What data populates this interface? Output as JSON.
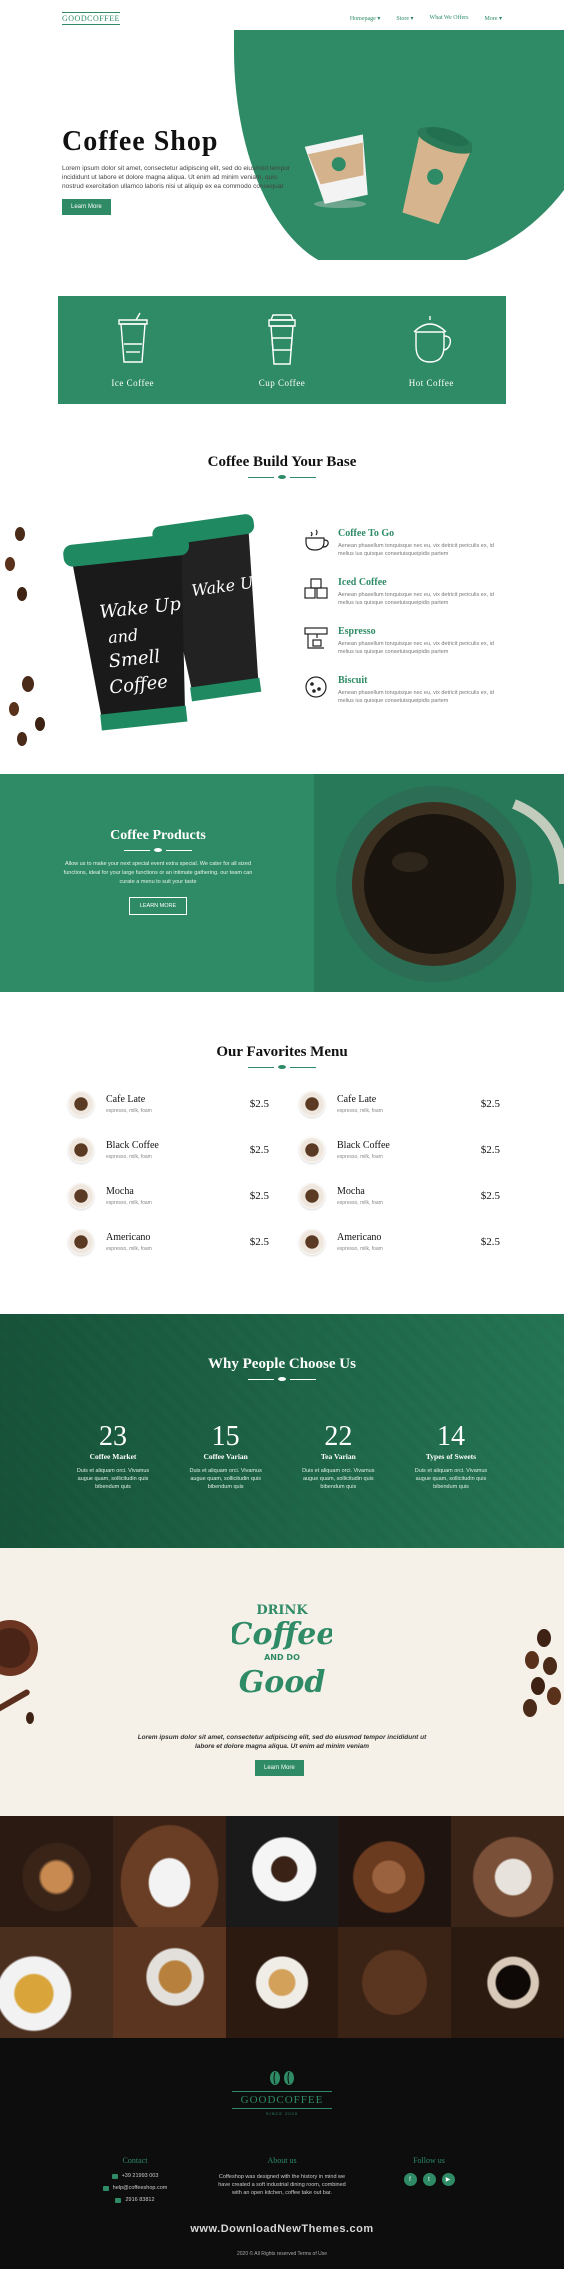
{
  "nav": {
    "logo": "GOODCOFFEE",
    "items": [
      {
        "label": "Homepage ▾"
      },
      {
        "label": "Store ▾"
      },
      {
        "label": "What We Offers"
      },
      {
        "label": "More ▾"
      }
    ]
  },
  "hero": {
    "title": "Coffee Shop",
    "text": "Lorem ipsum dolor sit amet, consectetur adipiscing elit, sed do eiusmod tempor incididunt ut labore et dolore magna aliqua. Ut enim ad minim veniam, quis nostrud exercitation ullamco laboris nisi ut aliquip ex ea commodo consequat",
    "button": "Learn More"
  },
  "categories": [
    {
      "label": "Ice Coffee"
    },
    {
      "label": "Cup Coffee"
    },
    {
      "label": "Hot Coffee"
    }
  ],
  "base": {
    "title": "Coffee Build Your Base",
    "features": [
      {
        "title": "Coffee To Go",
        "text": "Aenean phasellum tonquisque nec eu, vix detricit periculis ex, id melius ius quisque consetuisqueipidis partem"
      },
      {
        "title": "Iced Coffee",
        "text": "Aenean phasellum tonquisque nec eu, vix detricit periculis ex, id melius ius quisque consetuisqueipidis partem"
      },
      {
        "title": "Espresso",
        "text": "Aenean phasellum tonquisque nec eu, vix detricit periculis ex, id melius ius quisque consetuisqueipidis partem"
      },
      {
        "title": "Biscuit",
        "text": "Aenean phasellum tonquisque nec eu, vix detricit periculis ex, id melius ius quisque consetuisqueipidis partem"
      }
    ]
  },
  "products": {
    "title": "Coffee Products",
    "text": "Allow us to make your next special event extra special. We cater for all sized functions, ideal for your large functions or an intimate gathering. our team can curate a menu to suit your taste",
    "button": "LEARN MORE"
  },
  "favorites": {
    "title": "Our Favorites Menu",
    "items": [
      {
        "name": "Cafe Late",
        "desc": "espresso, milk, foam",
        "price": "$2.5"
      },
      {
        "name": "Cafe Late",
        "desc": "espresso, milk, foam",
        "price": "$2.5"
      },
      {
        "name": "Black Coffee",
        "desc": "espresso, milk, foam",
        "price": "$2.5"
      },
      {
        "name": "Black Coffee",
        "desc": "espresso, milk, foam",
        "price": "$2.5"
      },
      {
        "name": "Mocha",
        "desc": "espresso, milk, foam",
        "price": "$2.5"
      },
      {
        "name": "Mocha",
        "desc": "espresso, milk, foam",
        "price": "$2.5"
      },
      {
        "name": "Americano",
        "desc": "espresso, milk, foam",
        "price": "$2.5"
      },
      {
        "name": "Americano",
        "desc": "espresso, milk, foam",
        "price": "$2.5"
      }
    ]
  },
  "why": {
    "title": "Why People Choose Us",
    "stats": [
      {
        "number": "23",
        "label": "Coffee Market",
        "text": "Duis et aliquam orci. Vivamus augue quam, sollicitudin quis bibendum quis"
      },
      {
        "number": "15",
        "label": "Coffee Varian",
        "text": "Duis et aliquam orci. Vivamus augue quam, sollicitudin quis bibendum quis"
      },
      {
        "number": "22",
        "label": "Tea Varian",
        "text": "Duis et aliquam orci. Vivamus augue quam, sollicitudin quis bibendum quis"
      },
      {
        "number": "14",
        "label": "Types of Sweets",
        "text": "Duis et aliquam orci. Vivamus augue quam, sollicitudin quis bibendum quis"
      }
    ]
  },
  "drink": {
    "logo_line1": "DRINK",
    "logo_line2": "Coffee",
    "logo_line3": "AND DO",
    "logo_line4": "Good",
    "text": "Lorem ipsum dolor sit amet, consectetur adipiscing elit, sed do eiusmod tempor incididunt ut labore et dolore magna aliqua. Ut enim ad minim veniam",
    "button": "Learn More"
  },
  "footer": {
    "logo": "GOODCOFFEE",
    "since": "SINCE 2020",
    "contact_title": "Contact",
    "phone": "+39 21993 003",
    "email": "help@coffeeshop.com",
    "hours": "2916 83812",
    "about_title": "About us",
    "about_text": "Coffeshop was designed with the history in mind we have created a soft industrial dining room, combined with an open kitchen, coffee take out bar.",
    "follow_title": "Follow us",
    "socials": [
      "f",
      "t",
      "▶"
    ],
    "watermark": "www.DownloadNewThemes.com",
    "copyright": "2020 © All Rights reserved Terms of Use"
  },
  "colors": {
    "accent": "#2e8b66",
    "dark": "#0d0d0d",
    "cream": "#f6f1e8"
  }
}
